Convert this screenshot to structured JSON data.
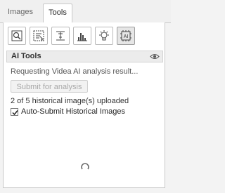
{
  "tabs": [
    {
      "label": "Images",
      "active": false
    },
    {
      "label": "Tools",
      "active": true
    }
  ],
  "toolbar": {
    "buttons": [
      {
        "icon": "zoom-target-icon"
      },
      {
        "icon": "text-selection-icon"
      },
      {
        "icon": "measure-text-icon"
      },
      {
        "icon": "histogram-icon"
      },
      {
        "icon": "lightbulb-icon"
      },
      {
        "icon": "ai-chip-icon",
        "active": true
      }
    ]
  },
  "ai_tools": {
    "title": "AI Tools",
    "status": "Requesting Videa AI analysis result...",
    "submit_label": "Submit for analysis",
    "uploaded_text": "2 of 5 historical image(s) uploaded",
    "auto_submit_label": "Auto-Submit Historical Images",
    "auto_submit_checked": true
  },
  "colors": {
    "border": "#c8c8c8",
    "header_bg": "#ececec",
    "disabled_text": "#a8a8a8"
  }
}
